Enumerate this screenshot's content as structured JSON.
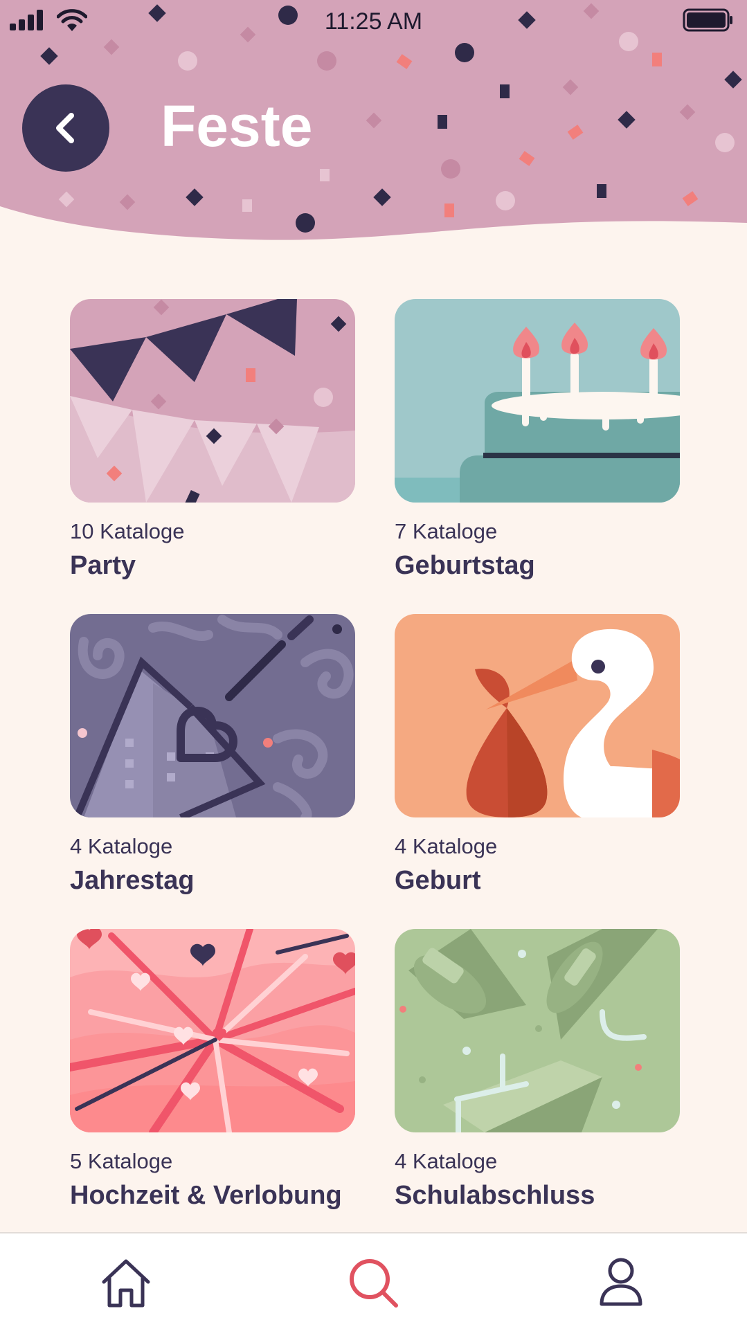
{
  "status_bar": {
    "time": "11:25 AM"
  },
  "header": {
    "title": "Feste",
    "back_icon": "chevron-left-icon"
  },
  "categories": [
    {
      "count": "10 Kataloge",
      "title": "Party",
      "illustration": "bunting-illustration"
    },
    {
      "count": "7 Kataloge",
      "title": "Geburtstag",
      "illustration": "cake-illustration"
    },
    {
      "count": "4 Kataloge",
      "title": "Jahrestag",
      "illustration": "anniversary-illustration"
    },
    {
      "count": "4 Kataloge",
      "title": "Geburt",
      "illustration": "stork-illustration"
    },
    {
      "count": "5 Kataloge",
      "title": "Hochzeit & Verlobung",
      "illustration": "fireworks-illustration"
    },
    {
      "count": "4 Kataloge",
      "title": "Schulabschluss",
      "illustration": "graduation-illustration"
    }
  ],
  "tab_bar": {
    "tabs": [
      {
        "icon": "home-icon",
        "active": false
      },
      {
        "icon": "search-icon",
        "active": true
      },
      {
        "icon": "user-icon",
        "active": false
      }
    ]
  },
  "colors": {
    "header": "#d4a3b8",
    "background": "#fdf4ee",
    "dark": "#3a3356",
    "accent": "#e05260"
  }
}
